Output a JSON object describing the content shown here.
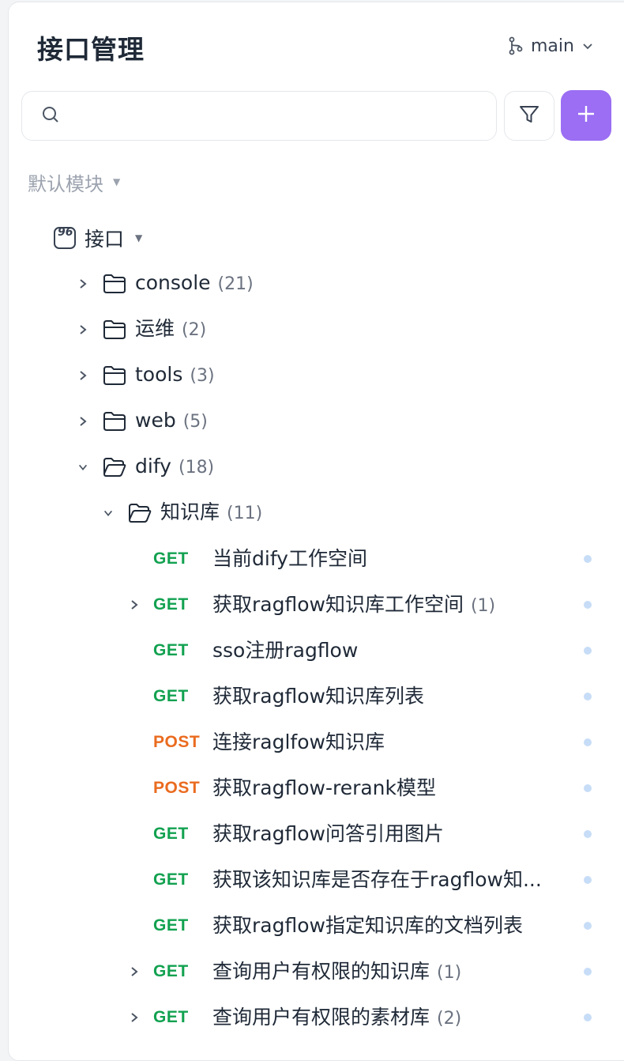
{
  "header": {
    "title": "接口管理",
    "branch": "main"
  },
  "search": {
    "placeholder": ""
  },
  "module": {
    "label": "默认模块"
  },
  "root": {
    "label": "接口"
  },
  "folders": [
    {
      "name": "console",
      "count": "(21)"
    },
    {
      "name": "运维",
      "count": "(2)"
    },
    {
      "name": "tools",
      "count": "(3)"
    },
    {
      "name": "web",
      "count": "(5)"
    },
    {
      "name": "dify",
      "count": "(18)"
    }
  ],
  "subfolder": {
    "name": "知识库",
    "count": "(11)"
  },
  "apis": [
    {
      "method": "GET",
      "name": "当前dify工作空间",
      "count": ""
    },
    {
      "method": "GET",
      "name": "获取ragflow知识库工作空间",
      "count": "(1)"
    },
    {
      "method": "GET",
      "name": "sso注册ragflow",
      "count": ""
    },
    {
      "method": "GET",
      "name": "获取ragflow知识库列表",
      "count": ""
    },
    {
      "method": "POST",
      "name": "连接raglfow知识库",
      "count": ""
    },
    {
      "method": "POST",
      "name": "获取ragflow-rerank模型",
      "count": ""
    },
    {
      "method": "GET",
      "name": "获取ragflow问答引用图片",
      "count": ""
    },
    {
      "method": "GET",
      "name": "获取该知识库是否存在于ragflow知...",
      "count": ""
    },
    {
      "method": "GET",
      "name": "获取ragflow指定知识库的文档列表",
      "count": ""
    },
    {
      "method": "GET",
      "name": "查询用户有权限的知识库",
      "count": "(1)"
    },
    {
      "method": "GET",
      "name": "查询用户有权限的素材库",
      "count": "(2)"
    }
  ],
  "colors": {
    "accent": "#9b6ef3",
    "get": "#12a150",
    "post": "#ea6b1f",
    "dot": "#c7ddf7"
  }
}
